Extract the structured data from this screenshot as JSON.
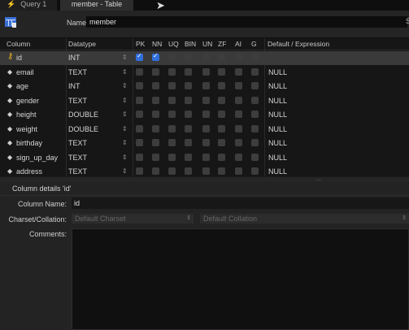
{
  "tabs": [
    {
      "label": "Query 1",
      "icon": "lightning-icon"
    },
    {
      "label": "member - Table"
    }
  ],
  "header": {
    "name_label": "Name:",
    "table_name": "member",
    "right_partial": "S"
  },
  "columns_header": [
    "Column",
    "Datatype",
    "PK",
    "NN",
    "UQ",
    "BIN",
    "UN",
    "ZF",
    "AI",
    "G",
    "Default / Expression"
  ],
  "rows": [
    {
      "name": "id",
      "type": "INT",
      "pk": true,
      "nn": true,
      "default": "",
      "marker": "key-icon"
    },
    {
      "name": "email",
      "type": "TEXT",
      "pk": false,
      "nn": false,
      "default": "NULL",
      "marker": "diamond-icon"
    },
    {
      "name": "age",
      "type": "INT",
      "pk": false,
      "nn": false,
      "default": "NULL",
      "marker": "diamond-icon"
    },
    {
      "name": "gender",
      "type": "TEXT",
      "pk": false,
      "nn": false,
      "default": "NULL",
      "marker": "diamond-icon"
    },
    {
      "name": "height",
      "type": "DOUBLE",
      "pk": false,
      "nn": false,
      "default": "NULL",
      "marker": "diamond-icon"
    },
    {
      "name": "weight",
      "type": "DOUBLE",
      "pk": false,
      "nn": false,
      "default": "NULL",
      "marker": "diamond-icon"
    },
    {
      "name": "birthday",
      "type": "TEXT",
      "pk": false,
      "nn": false,
      "default": "NULL",
      "marker": "diamond-icon"
    },
    {
      "name": "sign_up_day",
      "type": "TEXT",
      "pk": false,
      "nn": false,
      "default": "NULL",
      "marker": "diamond-icon"
    },
    {
      "name": "address",
      "type": "TEXT",
      "pk": false,
      "nn": false,
      "default": "NULL",
      "marker": "diamond-icon"
    }
  ],
  "details": {
    "title": "Column details 'id'",
    "column_name_label": "Column Name:",
    "column_name_value": "id",
    "charset_label": "Charset/Collation:",
    "charset_value": "Default Charset",
    "collation_value": "Default Collation",
    "comments_label": "Comments:"
  },
  "colors": {
    "accent_checkbox": "#2f6fdd",
    "key_icon": "#e6b422",
    "selected_row": "#3a3a3a"
  }
}
